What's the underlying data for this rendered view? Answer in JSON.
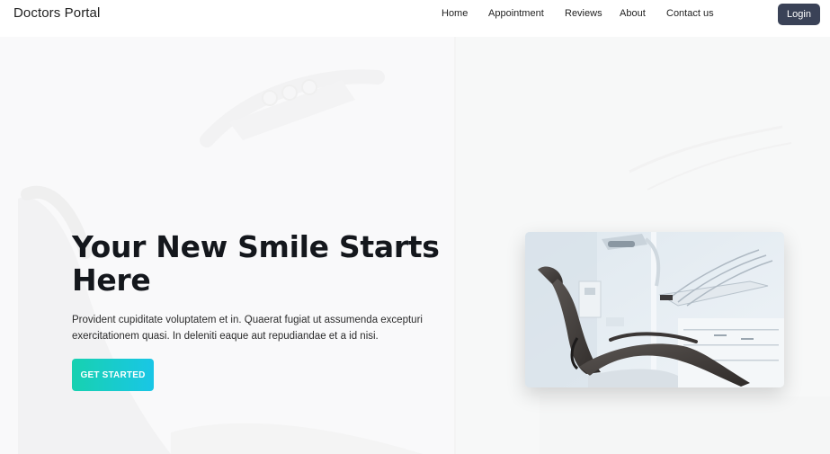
{
  "navbar": {
    "brand": "Doctors Portal",
    "links": [
      "Home",
      "Appointment",
      "Reviews",
      "About",
      "Contact us"
    ],
    "login_label": "Login"
  },
  "hero": {
    "title": "Your New Smile Starts Here",
    "description": "Provident cupiditate voluptatem et in. Quaerat fugiat ut assumenda excepturi exercitationem quasi. In deleniti eaque aut repudiandae et a id nisi.",
    "cta_label": "GET STARTED",
    "image": "dental-chair-photo"
  },
  "colors": {
    "login_button": "#3a4257",
    "cta_gradient_start": "#17d1b0",
    "cta_gradient_end": "#19c6e6",
    "hero_background": "#f7f7f8"
  }
}
